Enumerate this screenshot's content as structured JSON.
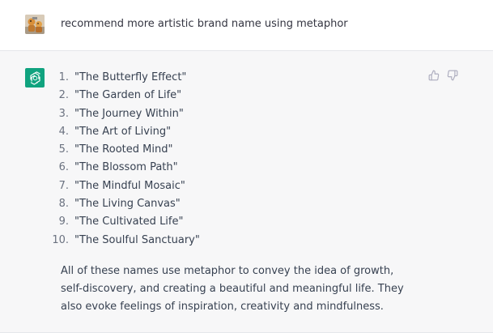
{
  "user_message": {
    "text": "recommend more artistic brand name using metaphor"
  },
  "assistant_message": {
    "list": [
      {
        "num": "1.",
        "text": "\"The Butterfly Effect\""
      },
      {
        "num": "2.",
        "text": "\"The Garden of Life\""
      },
      {
        "num": "3.",
        "text": "\"The Journey Within\""
      },
      {
        "num": "4.",
        "text": "\"The Art of Living\""
      },
      {
        "num": "5.",
        "text": "\"The Rooted Mind\""
      },
      {
        "num": "6.",
        "text": "\"The Blossom Path\""
      },
      {
        "num": "7.",
        "text": "\"The Mindful Mosaic\""
      },
      {
        "num": "8.",
        "text": "\"The Living Canvas\""
      },
      {
        "num": "9.",
        "text": "\"The Cultivated Life\""
      },
      {
        "num": "10.",
        "text": "\"The Soulful Sanctuary\""
      }
    ],
    "summary": "All of these names use metaphor to convey the idea of growth, self-discovery, and creating a beautiful and meaningful life. They also evoke feelings of inspiration, creativity and mindfulness."
  },
  "icons": {
    "user_avatar": "user-avatar-image",
    "assistant_avatar": "openai-logo-icon",
    "thumbs_up": "thumbs-up-icon",
    "thumbs_down": "thumbs-down-icon"
  },
  "colors": {
    "assistant_bg": "#f7f7f8",
    "logo_bg": "#10a37f",
    "text": "#374151",
    "icon_gray": "#acacbe"
  }
}
